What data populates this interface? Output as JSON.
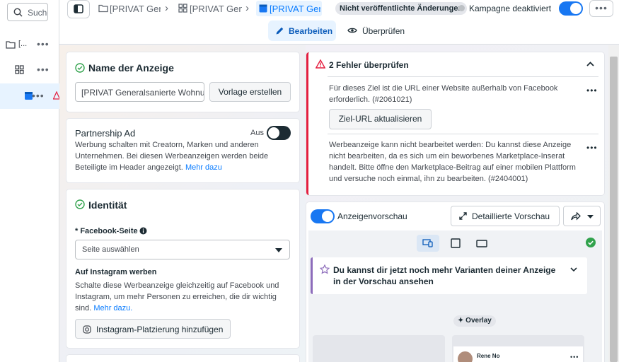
{
  "rail": {
    "search_placeholder": "Suche",
    "rows": [
      {
        "label": "[...",
        "icon": "folder-icon"
      },
      {
        "label": "",
        "icon": "grid-icon"
      },
      {
        "label": "",
        "icon": "ad-icon"
      }
    ]
  },
  "breadcrumb": {
    "items": [
      {
        "label": "[PRIVAT Gen",
        "icon": "folder-icon"
      },
      {
        "label": "[PRIVAT Gen",
        "icon": "grid-icon"
      },
      {
        "label": "[PRIVAT Gen",
        "icon": "ad-icon"
      }
    ],
    "separator": "›"
  },
  "header": {
    "badge": "Nicht veröffentlichte Änderungen",
    "status": "Kampagne deaktiviert",
    "more": "•••"
  },
  "tabs": {
    "edit": "Bearbeiten",
    "review": "Überprüfen"
  },
  "ad_name": {
    "title": "Name der Anzeige",
    "value": "[PRIVAT Generalsanierte Wohnung",
    "template_button": "Vorlage erstellen"
  },
  "partnership": {
    "title": "Partnership Ad",
    "toggle_label": "Aus",
    "description": "Werbung schalten mit Creatorn, Marken und anderen Unternehmen. Bei diesen Werbeanzeigen werden beide Beteiligte im Header angezeigt.",
    "link": "Mehr dazu"
  },
  "identity": {
    "title": "Identität",
    "fb_page_label": "* Facebook-Seite",
    "fb_page_placeholder": "Seite auswählen",
    "instagram_title": "Auf Instagram werben",
    "instagram_text": "Schalte diese Werbeanzeige gleichzeitig auf Facebook und Instagram, um mehr Personen zu erreichen, die dir wichtig sind.",
    "instagram_link": "Mehr dazu.",
    "instagram_button": "Instagram-Platzierung hinzufügen"
  },
  "errors": {
    "title": "2 Fehler überprüfen",
    "items": [
      {
        "text": "Für dieses Ziel ist die URL einer Website außerhalb von Facebook erforderlich. (#2061021)",
        "button": "Ziel-URL aktualisieren"
      },
      {
        "text": "Werbeanzeige kann nicht bearbeitet werden: Du kannst diese Anzeige nicht bearbeiten, da es sich um ein beworbenes Marketplace-Inserat handelt. Bitte öffne den Marketplace-Beitrag auf einer mobilen Plattform und versuche noch einmal, ihn zu bearbeiten. (#2404001)"
      }
    ],
    "more": "•••"
  },
  "preview": {
    "toggle_label": "Anzeigenvorschau",
    "detail_button": "Detaillierte Vorschau",
    "variants_text": "Du kannst dir jetzt noch mehr Varianten deiner Anzeige in der Vorschau ansehen",
    "overlay_label": "Overlay",
    "profile_name": "Rene No"
  },
  "colors": {
    "accent": "#0a7cff",
    "error": "#e41e3f",
    "success": "#31a24c",
    "toggle_on": "#1877f2",
    "toggle_off": "#1c2b33",
    "purple": "#8d6cbb"
  }
}
